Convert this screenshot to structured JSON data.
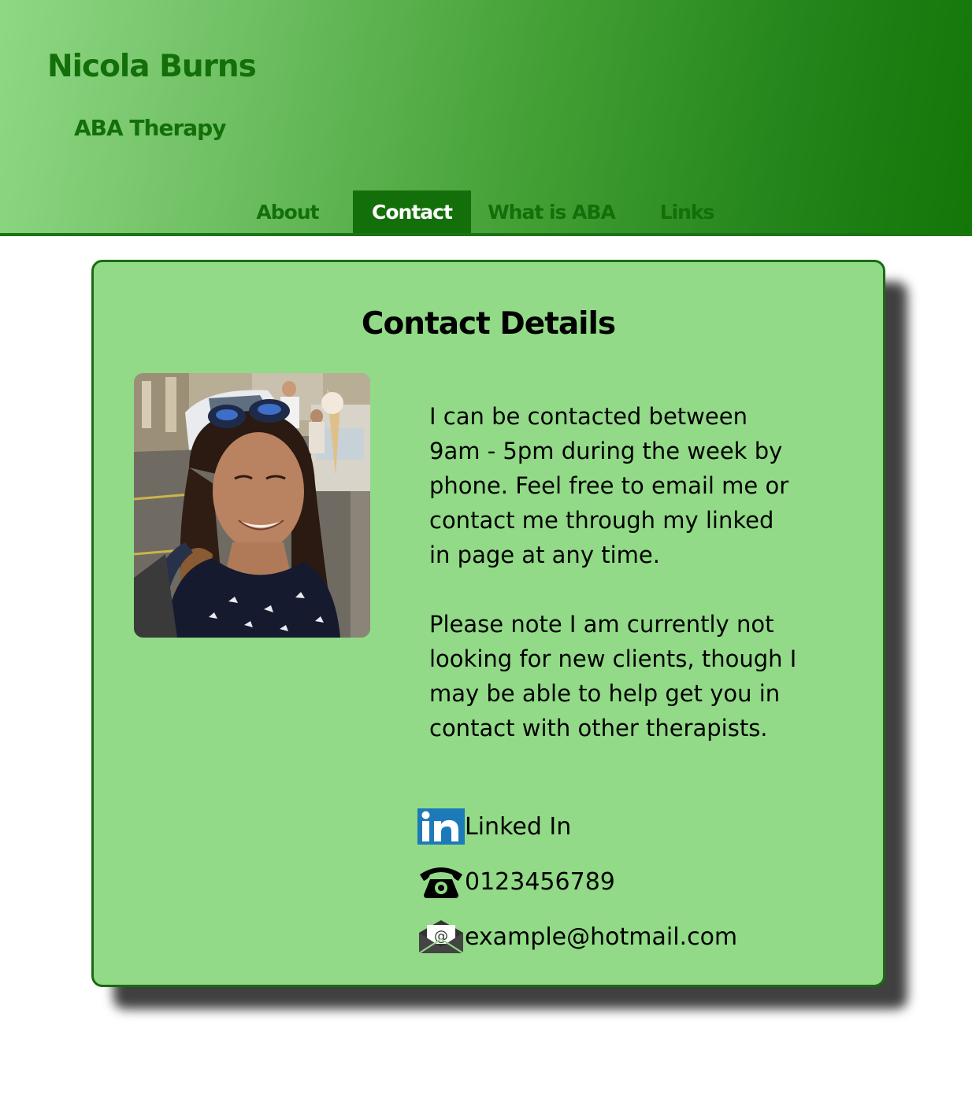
{
  "header": {
    "title": "Nicola Burns",
    "subtitle": "ABA Therapy"
  },
  "nav": {
    "items": [
      {
        "label": "About",
        "active": false
      },
      {
        "label": "Contact",
        "active": true
      },
      {
        "label": "What is ABA",
        "active": false
      },
      {
        "label": "Links",
        "active": false
      }
    ]
  },
  "contact": {
    "heading": "Contact Details",
    "paragraph1": "I can be contacted between 9am - 5pm during the week by phone. Feel free to email me or contact me through my linked in page at any time.",
    "paragraph2": "Please note I am currently not looking for new clients, though I may be able to help get you in contact with other therapists.",
    "linkedin": {
      "label": "Linked In",
      "icon": "linkedin-icon"
    },
    "phone": {
      "label": "0123456789",
      "icon": "telephone-icon"
    },
    "email": {
      "label": "example@hotmail.com",
      "icon": "envelope-icon"
    }
  },
  "colors": {
    "brand_green": "#136f09",
    "card_green": "#92da87",
    "linkedin_blue": "#1d7ab9"
  }
}
